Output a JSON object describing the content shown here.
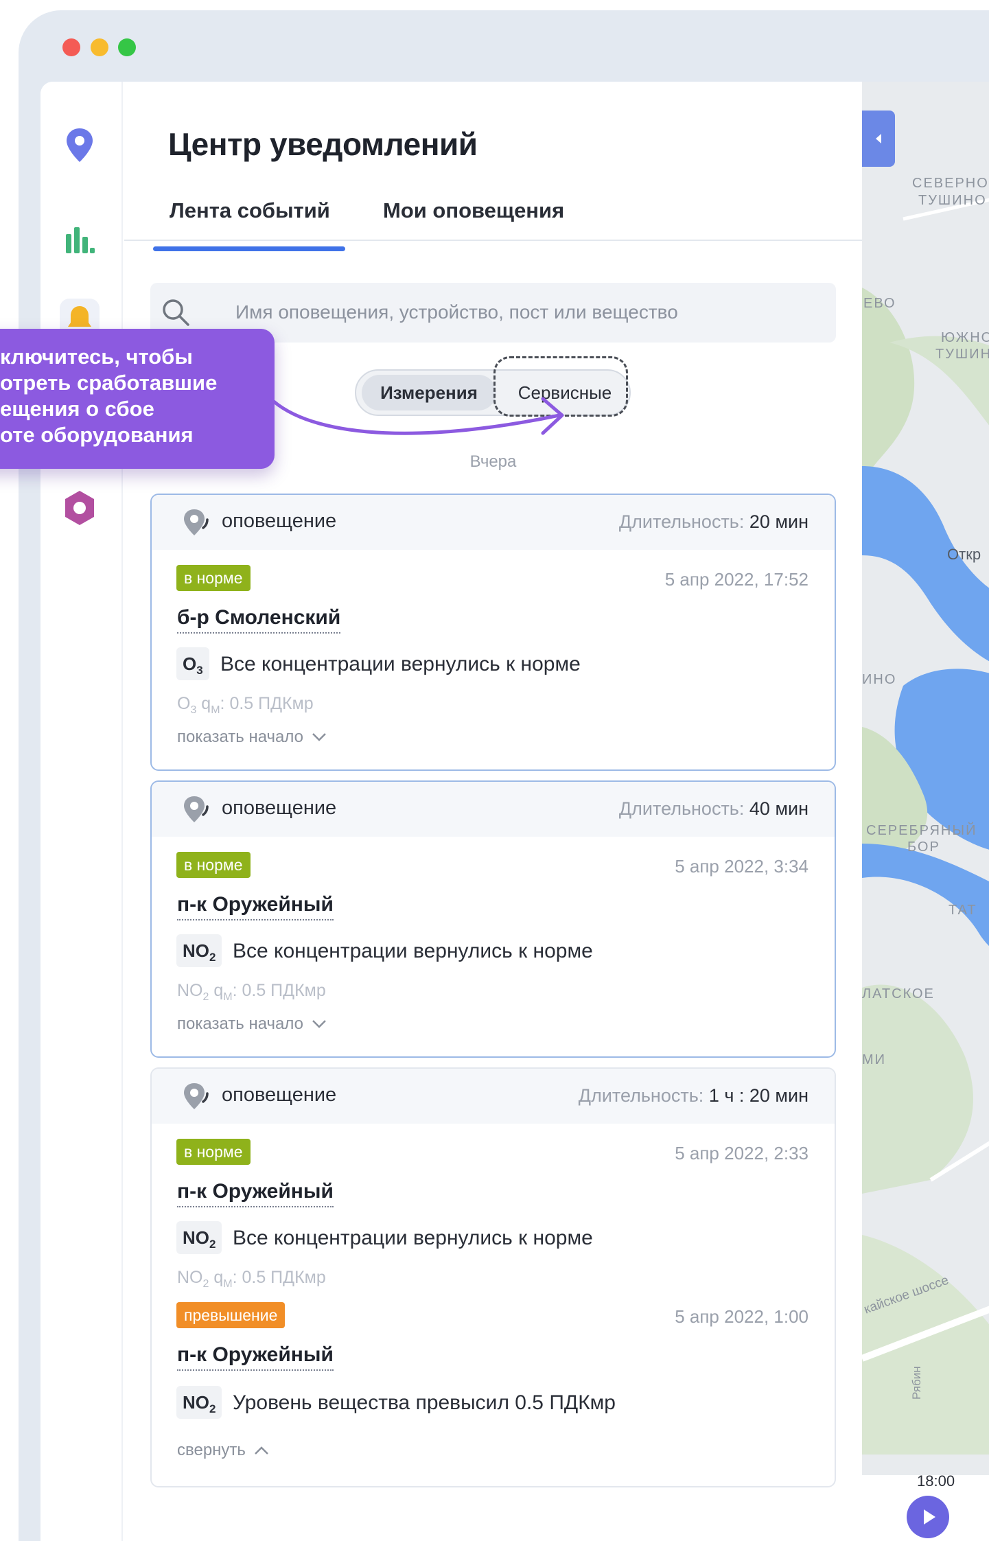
{
  "header": {
    "title": "Центр уведомлений"
  },
  "tabs": [
    {
      "label": "Лента событий",
      "active": true
    },
    {
      "label": "Мои оповещения",
      "active": false
    }
  ],
  "search": {
    "placeholder": "Имя оповещения, устройство, пост или вещество"
  },
  "segmented": {
    "measurements": "Измерения",
    "service": "Сервисные"
  },
  "callout": {
    "text": "ключитесь, чтобы\nотреть сработавшие\nещения о сбое\nоте оборудования"
  },
  "date_separator": "Вчера",
  "cards": [
    {
      "type": "оповещение",
      "duration_label": "Длительность:",
      "duration_value": "20 мин",
      "events": [
        {
          "status": "в норме",
          "time": "5 апр 2022, 17:52",
          "post": "б-р Смоленский",
          "chem": "O",
          "chem_sub": "3",
          "message": "Все концентрации вернулись к норме",
          "meta_chem": "O",
          "meta_sub": "3",
          "meta_q": " q",
          "meta_q_sub": "M",
          "meta_val": ": 0.5 ПДКмр"
        }
      ],
      "toggle": "показать начало"
    },
    {
      "type": "оповещение",
      "duration_label": "Длительность:",
      "duration_value": "40 мин",
      "events": [
        {
          "status": "в норме",
          "time": "5 апр 2022, 3:34",
          "post": "п-к Оружейный",
          "chem": "NO",
          "chem_sub": "2",
          "message": "Все концентрации вернулись к норме",
          "meta_chem": "NO",
          "meta_sub": "2",
          "meta_q": " q",
          "meta_q_sub": "M",
          "meta_val": ": 0.5 ПДКмр"
        }
      ],
      "toggle": "показать начало"
    },
    {
      "type": "оповещение",
      "duration_label": "Длительность:",
      "duration_value": "1 ч : 20 мин",
      "events": [
        {
          "status": "в норме",
          "time": "5 апр 2022, 2:33",
          "post": "п-к Оружейный",
          "chem": "NO",
          "chem_sub": "2",
          "message": "Все концентрации вернулись к норме",
          "meta_chem": "NO",
          "meta_sub": "2",
          "meta_q": " q",
          "meta_q_sub": "M",
          "meta_val": ": 0.5 ПДКмр"
        },
        {
          "status": "превышение",
          "time": "5 апр 2022, 1:00",
          "post": "п-к Оружейный",
          "chem": "NO",
          "chem_sub": "2",
          "message": "Уровень вещества превысил 0.5 ПДКмр"
        }
      ],
      "toggle": "свернуть"
    }
  ],
  "map": {
    "labels": [
      "СЕВЕРНО",
      "ТУШИНО",
      "ЕВО",
      "ЮЖНО",
      "ТУШИН",
      "Откр",
      "ИНО",
      "СЕРЕБРЯНЫЙ",
      "БОР",
      "ТАТ",
      "ЛАТСКОЕ",
      "МИ",
      "кайское шоссе",
      "Рябин"
    ],
    "time": "18:00"
  },
  "colors": {
    "accent": "#3f72e8",
    "ok": "#8fb21b",
    "warn": "#f18e27",
    "callout": "#8c5ae0"
  }
}
